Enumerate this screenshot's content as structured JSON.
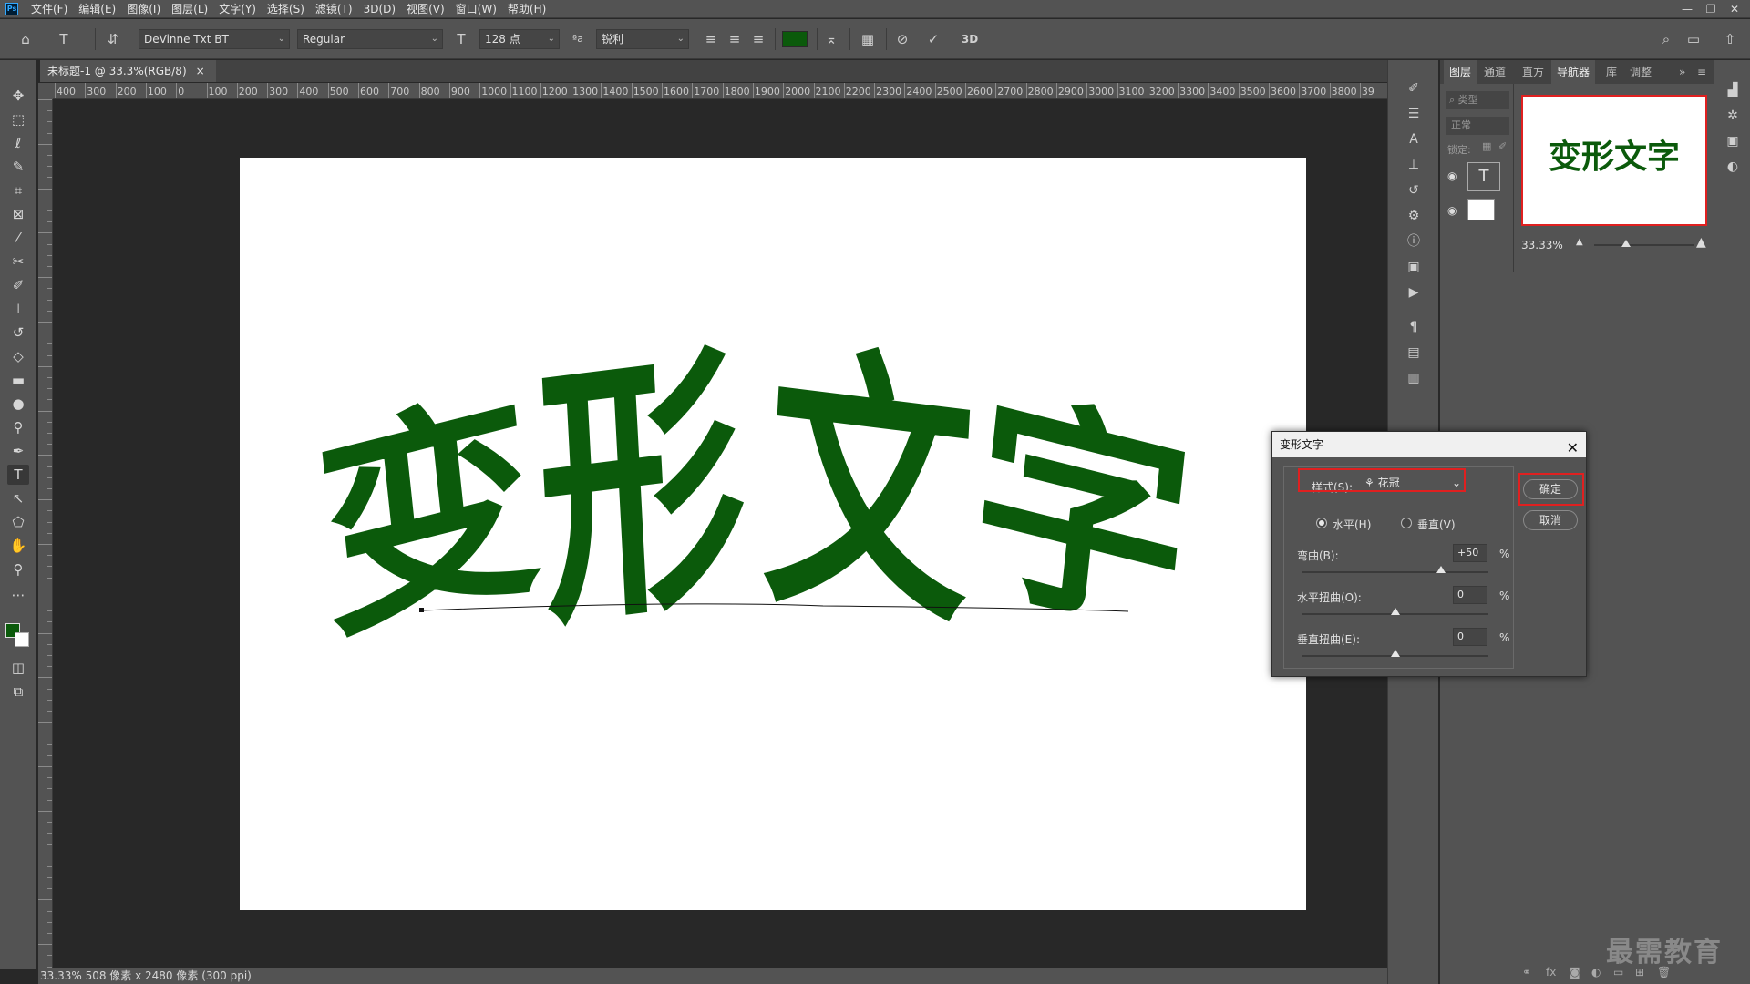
{
  "menubar": {
    "logo": "Ps",
    "items": [
      "文件(F)",
      "编辑(E)",
      "图像(I)",
      "图层(L)",
      "文字(Y)",
      "选择(S)",
      "滤镜(T)",
      "3D(D)",
      "视图(V)",
      "窗口(W)",
      "帮助(H)"
    ],
    "window_controls": [
      "—",
      "❐",
      "✕"
    ]
  },
  "options": {
    "font_family": "DeVinne Txt BT",
    "font_style": "Regular",
    "font_size": "128 点",
    "aa_label": "ªa",
    "antialias": "锐利",
    "text_color": "#0b5a0b",
    "three_d": "3D"
  },
  "document": {
    "tab_title": "未标题-1 @ 33.3%(RGB/8)",
    "tab_close": "×",
    "text": "变形文字",
    "text_color": "#0b5a0b"
  },
  "ruler_top": [
    "400",
    "300",
    "200",
    "100",
    "0",
    "100",
    "200",
    "300",
    "400",
    "500",
    "600",
    "700",
    "800",
    "900",
    "1000",
    "1100",
    "1200",
    "1300",
    "1400",
    "1500",
    "1600",
    "1700",
    "1800",
    "1900",
    "2000",
    "2100",
    "2200",
    "2300",
    "2400",
    "2500",
    "2600",
    "2700",
    "2800",
    "2900",
    "3000",
    "3100",
    "3200",
    "3300",
    "3400",
    "3500",
    "3600",
    "3700",
    "3800",
    "39"
  ],
  "status": {
    "text": "33.33% 508 像素 x 2480 像素 (300 ppi)"
  },
  "panels": {
    "tabs": [
      "图层",
      "通道",
      "直方",
      "导航器",
      "库",
      "调整"
    ],
    "layers_search": "类型",
    "blend_mode": "正常",
    "lock_label": "锁定:",
    "navigator_zoom": "33.33%"
  },
  "dialog": {
    "title": "变形文字",
    "style_label": "样式(S):",
    "style_value": "花冠",
    "horizontal_label": "水平(H)",
    "vertical_label": "垂直(V)",
    "bend_label": "弯曲(B):",
    "bend_value": "+50",
    "hdistort_label": "水平扭曲(O):",
    "hdistort_value": "0",
    "vdistort_label": "垂直扭曲(E):",
    "vdistort_value": "0",
    "percent": "%",
    "ok": "确定",
    "cancel": "取消"
  },
  "watermark": "最需教育"
}
